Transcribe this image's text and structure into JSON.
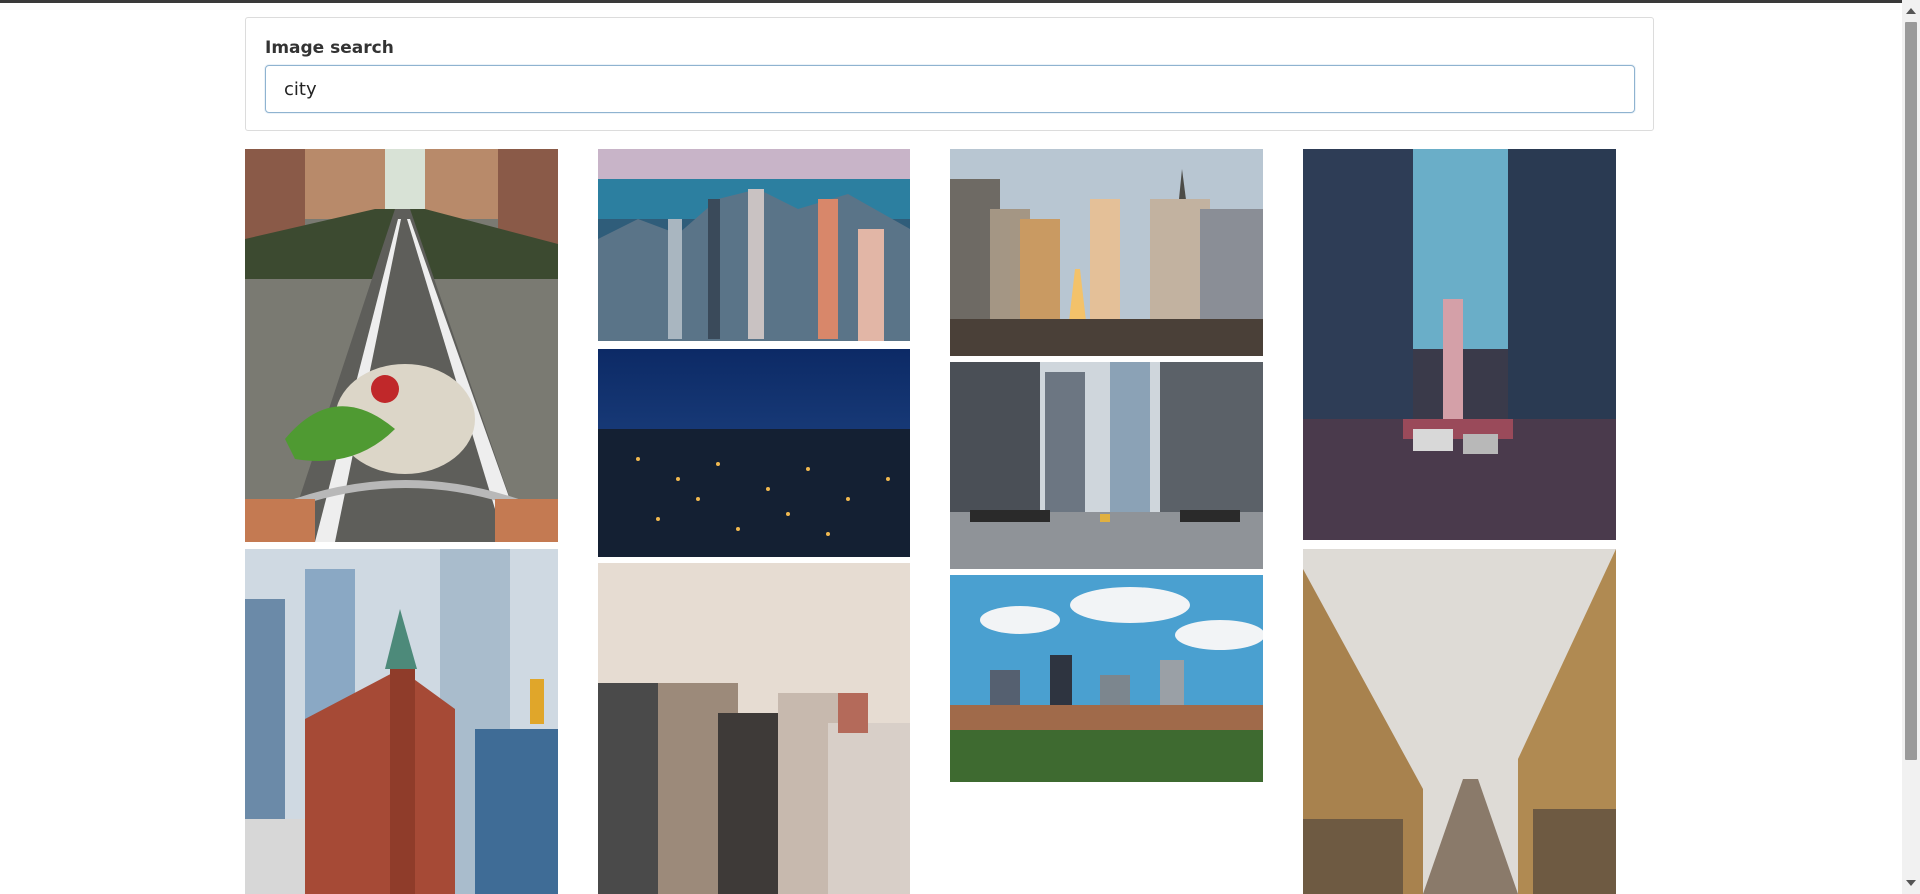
{
  "search": {
    "label": "Image search",
    "value": "city"
  },
  "images": [
    {
      "name": "cycling-street-groceries-photo"
    },
    {
      "name": "skyline-by-lake-photo"
    },
    {
      "name": "night-city-lights-photo"
    },
    {
      "name": "skyscraper-avenue-sunlight-photo"
    },
    {
      "name": "busy-street-traffic-photo"
    },
    {
      "name": "river-city-skyline-clouds-photo"
    },
    {
      "name": "downtown-street-tall-buildings-photo"
    },
    {
      "name": "flatiron-red-building-photo"
    },
    {
      "name": "foggy-skyscrapers-photo"
    },
    {
      "name": "cobblestone-old-street-photo"
    }
  ]
}
